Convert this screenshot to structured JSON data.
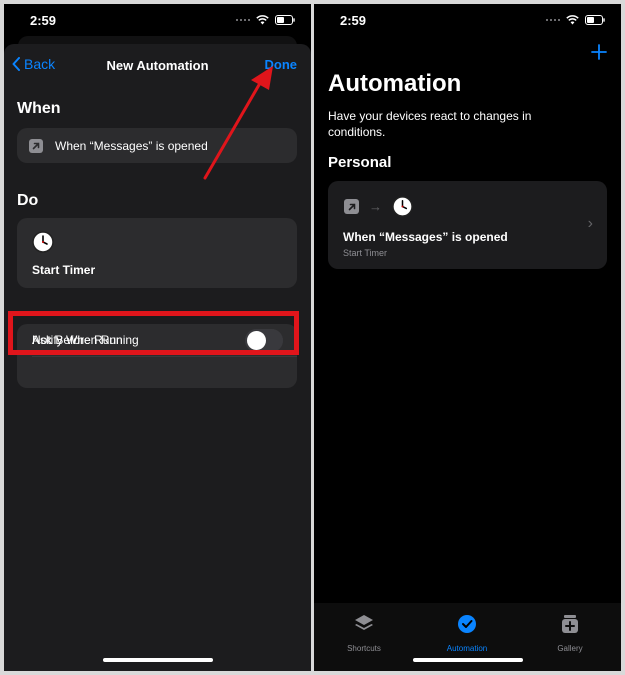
{
  "left": {
    "status": {
      "time": "2:59"
    },
    "nav": {
      "back_label": "Back",
      "title": "New Automation",
      "done_label": "Done"
    },
    "when": {
      "title": "When",
      "trigger_text": "When “Messages” is opened",
      "trigger_icon": "arrow-up-right-icon"
    },
    "do": {
      "title": "Do",
      "action_label": "Start Timer",
      "action_icon": "clock-icon"
    },
    "settings": [
      {
        "label": "Ask Before Running",
        "enabled": false
      },
      {
        "label": "Notify When Run",
        "enabled": false
      }
    ],
    "annotation_color": "#e0151b"
  },
  "right": {
    "status": {
      "time": "2:59"
    },
    "title": "Automation",
    "subtitle": "Have your devices react to changes in conditions.",
    "group_title": "Personal",
    "automation": {
      "title": "When “Messages” is opened",
      "subtitle": "Start Timer"
    },
    "tabs": [
      {
        "label": "Shortcuts",
        "icon": "layers-icon",
        "active": false
      },
      {
        "label": "Automation",
        "icon": "clock-check-icon",
        "active": true
      },
      {
        "label": "Gallery",
        "icon": "gallery-icon",
        "active": false
      }
    ]
  },
  "colors": {
    "accent": "#0a84ff",
    "card": "#2c2c2e",
    "sheet": "#1c1c1e"
  }
}
